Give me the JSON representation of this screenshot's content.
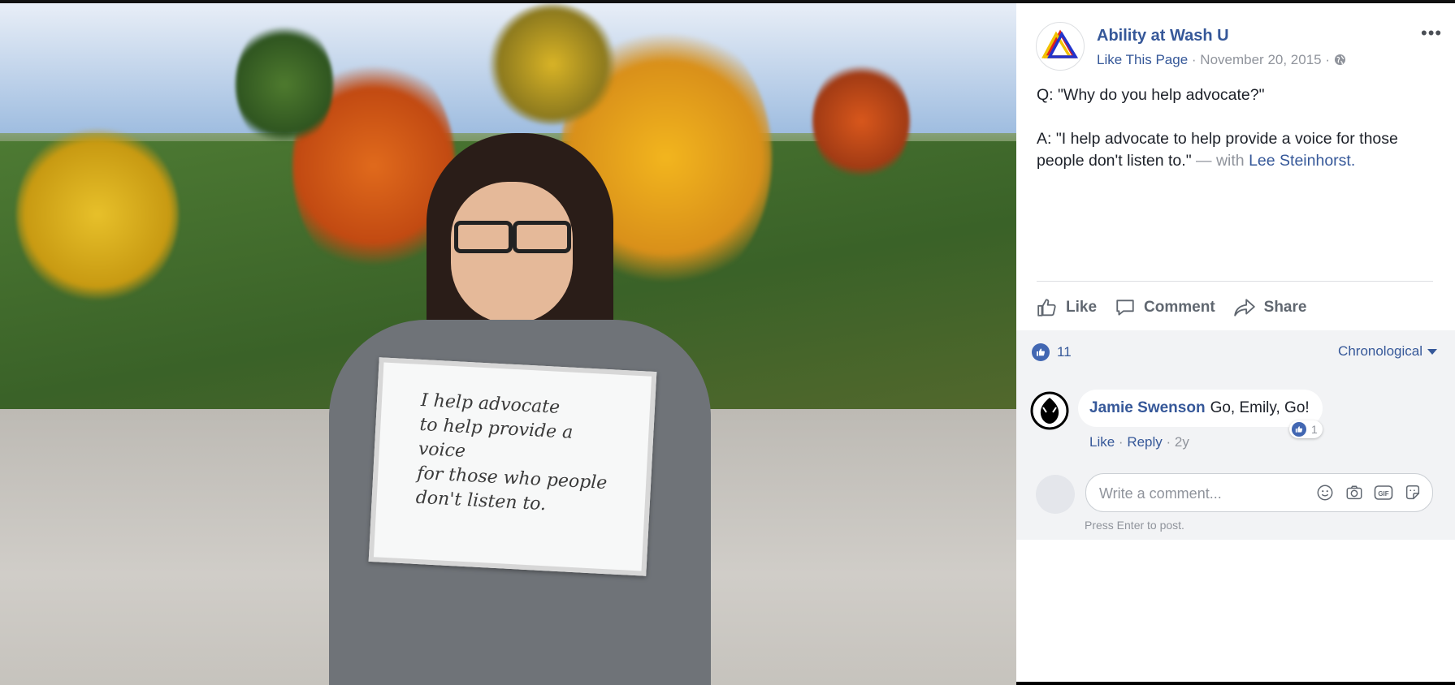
{
  "photo": {
    "whiteboard_text": "I help advocate\nto help provide a voice\nfor those who people\ndon't listen to."
  },
  "post": {
    "page_name": "Ability at Wash U",
    "like_page": "Like This Page",
    "separator": "·",
    "date": "November 20, 2015",
    "more_icon": "more-options-icon",
    "text_q": "Q: \"Why do you help advocate?\"",
    "text_a": "A: \"I help advocate to help provide a voice for those people don't listen to.\"",
    "with_label": "— with",
    "tagged_name": "Lee Steinhorst."
  },
  "actions": {
    "like": "Like",
    "comment": "Comment",
    "share": "Share"
  },
  "reactions": {
    "count": "11",
    "sort": "Chronological"
  },
  "comment": {
    "author": "Jamie Swenson",
    "text": "Go, Emily, Go!",
    "reaction_count": "1",
    "like": "Like",
    "reply": "Reply",
    "time": "2y"
  },
  "composer": {
    "placeholder": "Write a comment...",
    "hint": "Press Enter to post."
  },
  "colors": {
    "link": "#365899",
    "meta": "#90949c",
    "like_blue": "#4267b2",
    "comments_bg": "#f2f3f5"
  }
}
